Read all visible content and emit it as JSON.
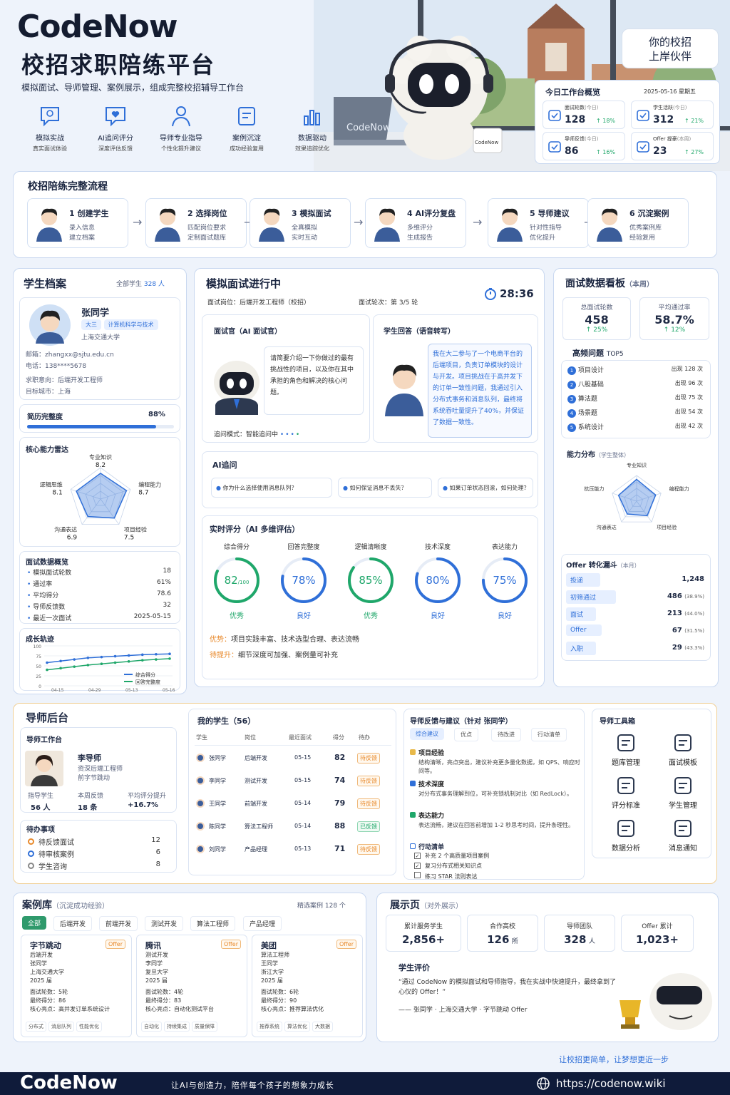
{
  "brand": {
    "logo": "CodeNow",
    "title": "校招求职陪练平台",
    "subtitle": "模拟面试、导师管理、案例展示，组成完整校招辅导工作台"
  },
  "features": [
    {
      "icon": "chat-bulb-icon",
      "title": "模拟实战",
      "desc": "真实面试体验"
    },
    {
      "icon": "chat-heart-icon",
      "title": "AI追问评分",
      "desc": "深度评估反馈"
    },
    {
      "icon": "mentor-icon",
      "title": "导师专业指导",
      "desc": "个性化提升建议"
    },
    {
      "icon": "case-icon",
      "title": "案例沉淀",
      "desc": "成功经验复用"
    },
    {
      "icon": "chart-icon",
      "title": "数据驱动",
      "desc": "效果追踪优化"
    }
  ],
  "hero": {
    "badge_line1": "你的校招",
    "badge_line2": "上岸伙伴",
    "laptop": "CodeNow",
    "mug": "CodeNow"
  },
  "today": {
    "title": "今日工作台概览",
    "date": "2025-05-16  星期五",
    "items": [
      {
        "icon": "check-icon",
        "label": "面试轮数",
        "period": "(今日)",
        "value": "128",
        "delta": "↑ 18%"
      },
      {
        "icon": "users-icon",
        "label": "学生活跃",
        "period": "(今日)",
        "value": "312",
        "delta": "↑ 21%"
      },
      {
        "icon": "user-icon",
        "label": "导师反馈",
        "period": "(今日)",
        "value": "86",
        "delta": "↑ 16%"
      },
      {
        "icon": "mail-icon",
        "label": "Offer 提豪",
        "period": "(本周)",
        "value": "23",
        "delta": "↑ 27%"
      }
    ]
  },
  "flow": {
    "title": "校招陪练完整流程",
    "steps": [
      {
        "title": "1 创建学生",
        "l1": "录入信息",
        "l2": "建立档案",
        "icon": "student-avatar-icon"
      },
      {
        "title": "2 选择岗位",
        "l1": "匹配岗位要求",
        "l2": "定制面试题库",
        "icon": "job-icon"
      },
      {
        "title": "3 模拟面试",
        "l1": "全真模拟",
        "l2": "实时互动",
        "icon": "interview-icon"
      },
      {
        "title": "4 AI评分复盘",
        "l1": "多维评分",
        "l2": "生成报告",
        "icon": "ai-brain-icon"
      },
      {
        "title": "5 导师建议",
        "l1": "针对性指导",
        "l2": "优化提升",
        "icon": "mentor-avatar-icon"
      },
      {
        "title": "6 沉淀案例",
        "l1": "优秀案例库",
        "l2": "经验复用",
        "icon": "case-avatar-icon"
      }
    ]
  },
  "profile": {
    "title": "学生档案",
    "all_label": "全部学生",
    "all_count": "328 人",
    "name": "张同学",
    "tag1": "大三",
    "tag2": "计算机科学与技术",
    "school": "上海交通大学",
    "email_label": "邮箱：",
    "email": "zhangxx@sjtu.edu.cn",
    "phone_label": "电话：",
    "phone": "138****5678",
    "intent_label": "求职意向：",
    "intent": "后端开发工程师",
    "city_label": "目标城市：",
    "city": "上海",
    "resume_label": "简历完整度",
    "resume_value": "88%",
    "resume_pct": 0.88,
    "radar_title": "核心能力雷达",
    "radar": [
      {
        "name": "专业知识",
        "value": "8.2"
      },
      {
        "name": "编程能力",
        "value": "8.7"
      },
      {
        "name": "项目经验",
        "value": "7.5"
      },
      {
        "name": "沟通表达",
        "value": "6.9"
      },
      {
        "name": "逻辑思维",
        "value": "8.1"
      }
    ],
    "overview_title": "面试数据概览",
    "overview": [
      {
        "k": "模拟面试轮数",
        "v": "18"
      },
      {
        "k": "通过率",
        "v": "61%"
      },
      {
        "k": "平均得分",
        "v": "78.6"
      },
      {
        "k": "导师反馈数",
        "v": "32"
      },
      {
        "k": "最近一次面试",
        "v": "2025-05-15"
      }
    ],
    "growth_title": "成长轨迹",
    "growth": {
      "y_ticks": [
        "100",
        "75",
        "50",
        "25",
        "0"
      ],
      "x_ticks": [
        "04-15",
        "04-29",
        "05-13",
        "05-16"
      ],
      "legend1": "综合得分",
      "legend2": "回答完整度",
      "s1": [
        58,
        62,
        66,
        70,
        72,
        74,
        76,
        78,
        79,
        80
      ],
      "s2": [
        40,
        44,
        48,
        52,
        55,
        58,
        61,
        64,
        66,
        68
      ]
    }
  },
  "interview": {
    "title": "模拟面试进行中",
    "timer": "28:36",
    "post_label": "面试岗位：",
    "post": "后端开发工程师（校招）",
    "round_label": "面试轮次：",
    "round": "第 3/5 轮",
    "interviewer_title": "面试官（AI 面试官）",
    "question": "请简要介绍一下你做过的最有挑战性的项目，以及你在其中承担的角色和解决的核心问题。",
    "mode_label": "追问模式：",
    "mode": "智能追问中",
    "answer_title": "学生回答（语音转写）",
    "answer": "我在大二参与了一个电商平台的后端项目，负责订单模块的设计与开发。项目挑战在于高并发下的订单一致性问题，我通过引入分布式事务和消息队列，最终将系统吞吐量提升了40%，并保证了数据一致性。",
    "followup_title": "AI追问",
    "followups": [
      "你为什么选择使用消息队列？",
      "如何保证消息不丢失？",
      "如果订单状态回滚，如何处理？"
    ],
    "score_title": "实时评分（AI 多维评估）",
    "scores": [
      {
        "name": "综合得分",
        "value": "82",
        "unit": "/100",
        "pct": 0.82,
        "grade": "优秀",
        "color": "#1fa76a"
      },
      {
        "name": "回答完整度",
        "value": "78%",
        "unit": "",
        "pct": 0.78,
        "grade": "良好",
        "color": "#2f6fd8"
      },
      {
        "name": "逻辑清晰度",
        "value": "85%",
        "unit": "",
        "pct": 0.85,
        "grade": "优秀",
        "color": "#1fa76a"
      },
      {
        "name": "技术深度",
        "value": "80%",
        "unit": "",
        "pct": 0.8,
        "grade": "良好",
        "color": "#2f6fd8"
      },
      {
        "name": "表达能力",
        "value": "75%",
        "unit": "",
        "pct": 0.75,
        "grade": "良好",
        "color": "#2f6fd8"
      }
    ],
    "adv_label": "优势：",
    "adv": "项目实践丰富、技术选型合理、表达流畅",
    "imp_label": "待提升：",
    "imp": "细节深度可加强、案例量可补充"
  },
  "board": {
    "title": "面试数据看板",
    "period": "（本周）",
    "k1_label": "总面试轮数",
    "k1": "458",
    "k1_delta": "↑ 25%",
    "k2_label": "平均通过率",
    "k2": "58.7%",
    "k2_delta": "↑ 12%",
    "top_title": "高频问题",
    "top_tag": "TOP5",
    "top": [
      {
        "n": "1",
        "name": "项目设计",
        "cnt": "出现 128 次"
      },
      {
        "n": "2",
        "name": "八股基础",
        "cnt": "出现 96 次"
      },
      {
        "n": "3",
        "name": "算法题",
        "cnt": "出现 75 次"
      },
      {
        "n": "4",
        "name": "场景题",
        "cnt": "出现 54 次"
      },
      {
        "n": "5",
        "name": "系统设计",
        "cnt": "出现 42 次"
      }
    ],
    "dist_title": "能力分布",
    "dist_sub": "（学生整体）",
    "dist_axes": [
      "专业知识",
      "编程能力",
      "项目经验",
      "沟通表达",
      "抗压能力"
    ],
    "funnel_title": "Offer 转化漏斗",
    "funnel_sub": "（本月）",
    "funnel": [
      {
        "k": "投递",
        "v": "1,248",
        "pct": ""
      },
      {
        "k": "初筛通过",
        "v": "486",
        "pct": "(38.9%)"
      },
      {
        "k": "面试",
        "v": "213",
        "pct": "(44.0%)"
      },
      {
        "k": "Offer",
        "v": "67",
        "pct": "(31.5%)"
      },
      {
        "k": "入职",
        "v": "29",
        "pct": "(43.3%)"
      }
    ]
  },
  "mentor": {
    "title": "导师后台",
    "ws_title": "导师工作台",
    "name": "李导师",
    "role": "资深后端工程师",
    "company": "前字节跳动",
    "s1_label": "指导学生",
    "s1": "56 人",
    "s2_label": "本周反馈",
    "s2": "18 条",
    "s3_label": "平均评分提升",
    "s3": "+16.7%",
    "todo_title": "待办事项",
    "todos": [
      {
        "k": "待反馈面试",
        "v": "12"
      },
      {
        "k": "待审核案例",
        "v": "6"
      },
      {
        "k": "学生咨询",
        "v": "8"
      }
    ]
  },
  "mystudents": {
    "title": "我的学生（56）",
    "cols": [
      "学生",
      "岗位",
      "最近面试",
      "得分",
      "待办"
    ],
    "rows": [
      {
        "name": "张同学",
        "job": "后端开发",
        "date": "05-15",
        "score": "82",
        "todo": "待反馈",
        "done": false
      },
      {
        "name": "李同学",
        "job": "测试开发",
        "date": "05-15",
        "score": "74",
        "todo": "待反馈",
        "done": false
      },
      {
        "name": "王同学",
        "job": "前端开发",
        "date": "05-14",
        "score": "79",
        "todo": "待反馈",
        "done": false
      },
      {
        "name": "陈同学",
        "job": "算法工程师",
        "date": "05-14",
        "score": "88",
        "todo": "已反馈",
        "done": true
      },
      {
        "name": "刘同学",
        "job": "产品经理",
        "date": "05-13",
        "score": "71",
        "todo": "待反馈",
        "done": false
      }
    ]
  },
  "feedback": {
    "title": "导师反馈与建议（针对 张同学）",
    "tabs": [
      "综合建议",
      "优点",
      "待改进",
      "行动清单"
    ],
    "items": [
      {
        "title": "项目经验",
        "text": "结构清晰，亮点突出，建议补充更多量化数据，如 QPS、响应时间等。",
        "color": "#e8b94a"
      },
      {
        "title": "技术深度",
        "text": "对分布式事务理解到位，可补充锁机制对比（如 RedLock）。",
        "color": "#2f6fd8"
      },
      {
        "title": "表达能力",
        "text": "表达流畅，建议在回答前增加 1-2 秒思考时间，提升条理性。",
        "color": "#1fa76a"
      }
    ],
    "action_title": "行动清单",
    "actions": [
      {
        "t": "补充 2 个高质量项目案例",
        "done": true
      },
      {
        "t": "复习分布式相关知识点",
        "done": true
      },
      {
        "t": "练习 STAR 法则表达",
        "done": false
      }
    ]
  },
  "tools": {
    "title": "导师工具箱",
    "items": [
      {
        "icon": "question-bank-icon",
        "label": "题库管理"
      },
      {
        "icon": "template-icon",
        "label": "面试模板"
      },
      {
        "icon": "rubric-icon",
        "label": "评分标准"
      },
      {
        "icon": "students-icon",
        "label": "学生管理"
      },
      {
        "icon": "analytics-icon",
        "label": "数据分析"
      },
      {
        "icon": "bell-icon",
        "label": "消息通知"
      }
    ]
  },
  "cases": {
    "title": "案例库",
    "sub": "（沉淀成功经验）",
    "count_label": "精选案例",
    "count": "128 个",
    "filters": [
      "全部",
      "后端开发",
      "前端开发",
      "测试开发",
      "算法工程师",
      "产品经理"
    ],
    "items": [
      {
        "company": "字节跳动",
        "badge": "Offer",
        "job": "后端开发",
        "name": "张同学",
        "school": "上海交通大学",
        "year": "2025 届",
        "rounds_label": "面试轮数：",
        "rounds": "5轮",
        "score_label": "最终得分：",
        "score": "86",
        "hl_label": "核心亮点：",
        "hl": "高并发订单系统设计",
        "tags": [
          "分布式",
          "消息队列",
          "性能优化"
        ]
      },
      {
        "company": "腾讯",
        "badge": "Offer",
        "job": "测试开发",
        "name": "李同学",
        "school": "复旦大学",
        "year": "2025 届",
        "rounds_label": "面试轮数：",
        "rounds": "4轮",
        "score_label": "最终得分：",
        "score": "83",
        "hl_label": "核心亮点：",
        "hl": "自动化测试平台",
        "tags": [
          "自动化",
          "持续集成",
          "质量保障"
        ]
      },
      {
        "company": "美团",
        "badge": "Offer",
        "job": "算法工程师",
        "name": "王同学",
        "school": "浙江大学",
        "year": "2025 届",
        "rounds_label": "面试轮数：",
        "rounds": "6轮",
        "score_label": "最终得分：",
        "score": "90",
        "hl_label": "核心亮点：",
        "hl": "推荐算法优化",
        "tags": [
          "推荐系统",
          "算法优化",
          "大数据"
        ]
      }
    ]
  },
  "showcase": {
    "title": "展示页",
    "sub": "（对外展示）",
    "stats": [
      {
        "k": "累计服务学生",
        "v": "2,856+",
        "u": ""
      },
      {
        "k": "合作高校",
        "v": "126",
        "u": "所"
      },
      {
        "k": "导师团队",
        "v": "328",
        "u": "人"
      },
      {
        "k": "Offer 累计",
        "v": "1,023+",
        "u": ""
      }
    ],
    "review_title": "学生评价",
    "review": "“通过 CodeNow 的模拟面试和导师指导，我在实战中快速提升，最终拿到了心仪的 Offer！”",
    "review_by": "—— 张同学 · 上海交通大学 · 字节跳动 Offer"
  },
  "footer": {
    "slogan": "让校招更简单，让梦想更近一步",
    "logo": "CodeNow",
    "tagline": "让AI与创造力，陪伴每个孩子的想象力成长",
    "url": "https://codenow.wiki",
    "globe": "globe-icon"
  }
}
